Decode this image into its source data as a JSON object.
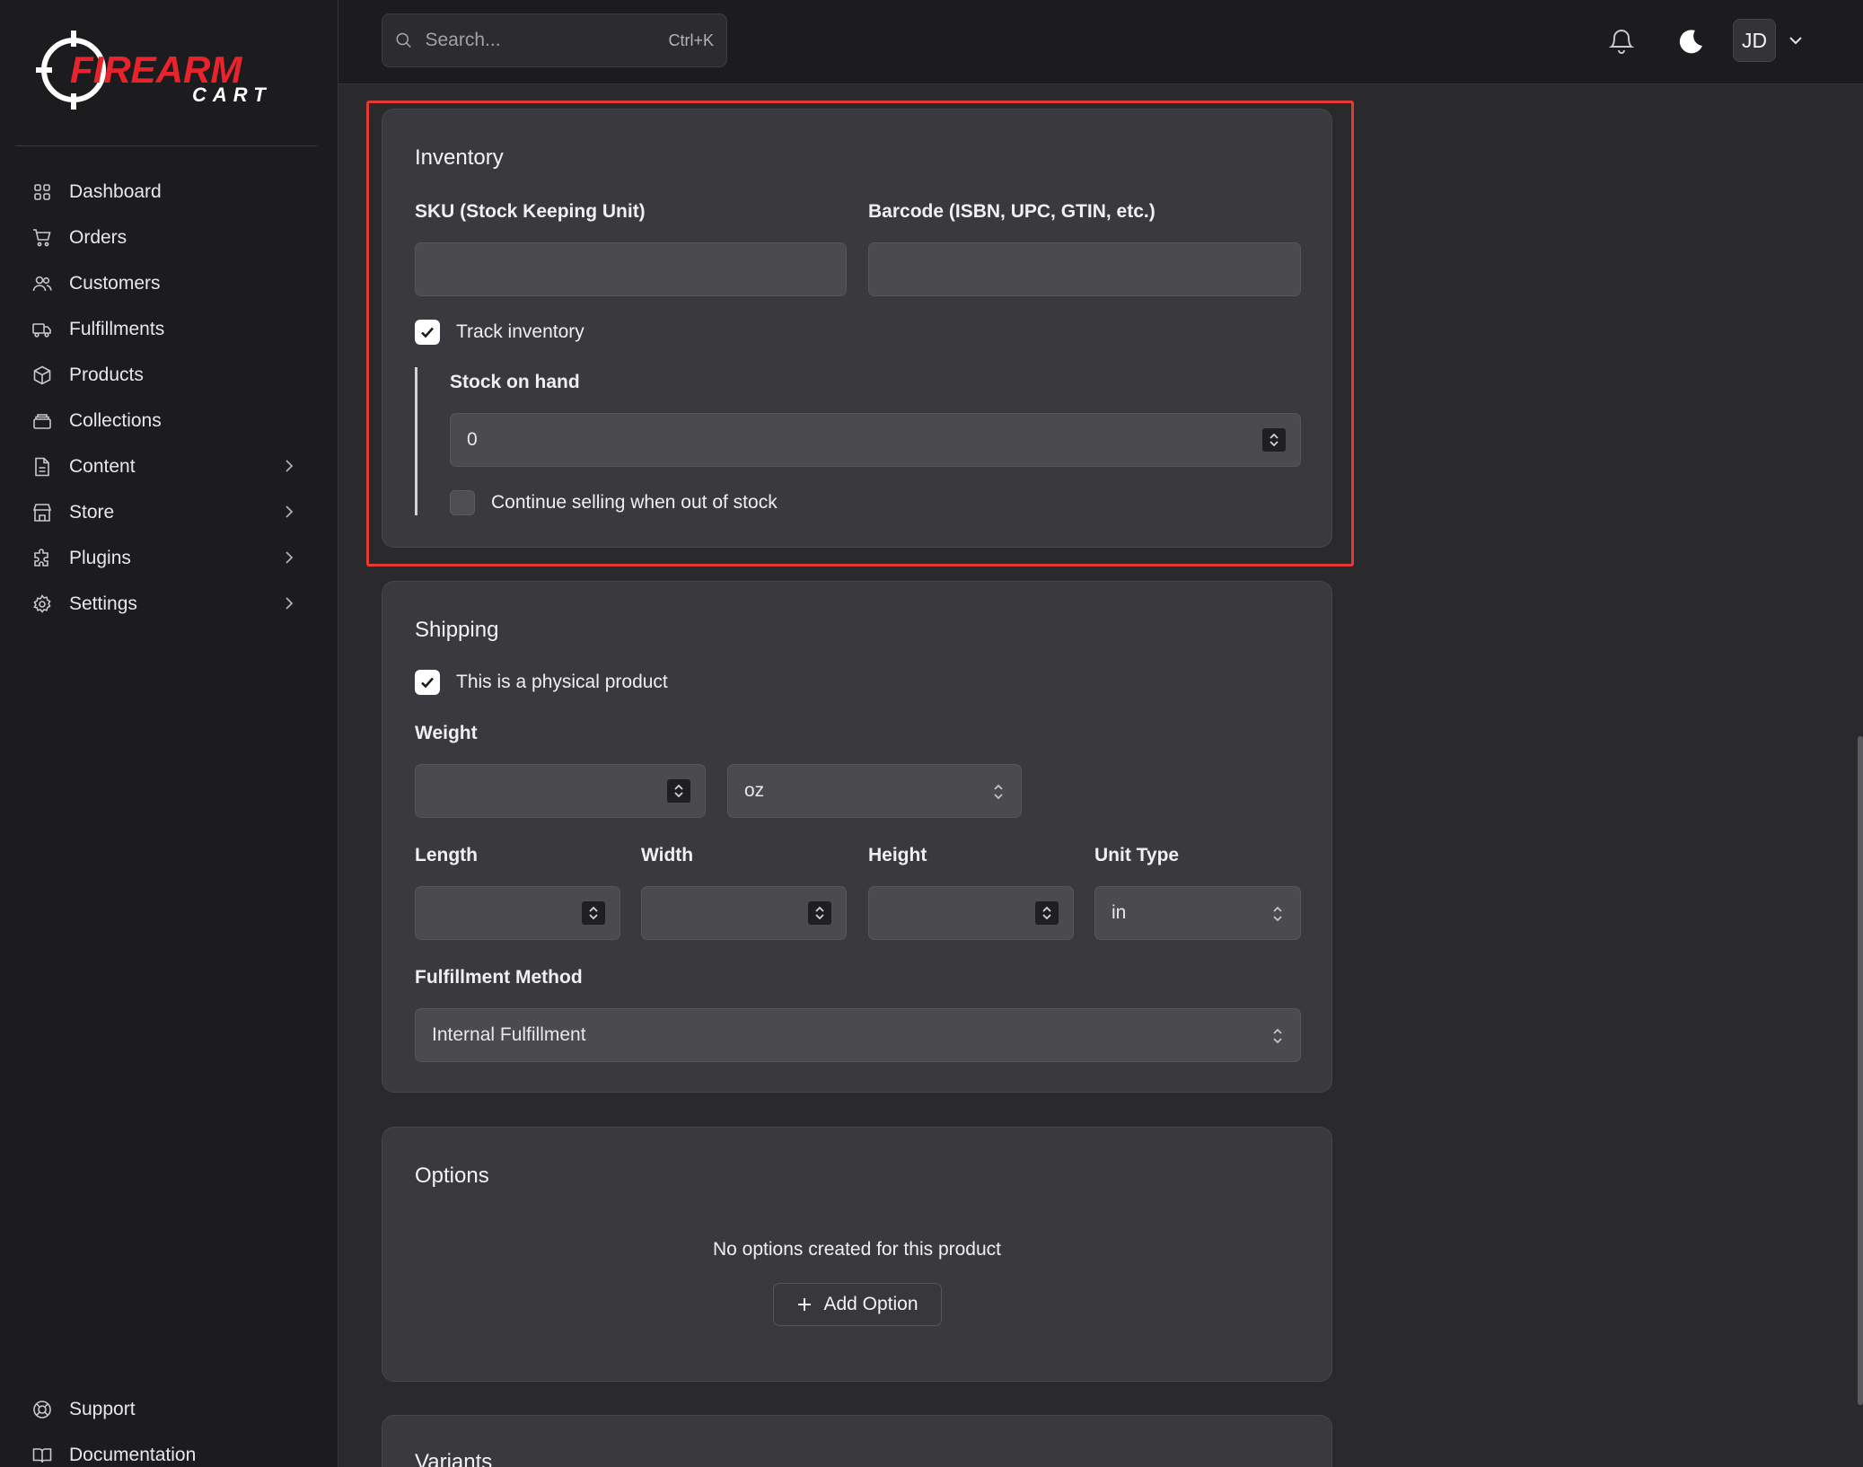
{
  "brand": {
    "logo_text_top": "FIREARM",
    "logo_text_bottom": "CART",
    "logo_color": "#e8232b"
  },
  "sidebar": {
    "items": [
      {
        "label": "Dashboard",
        "icon": "grid-icon"
      },
      {
        "label": "Orders",
        "icon": "cart-icon"
      },
      {
        "label": "Customers",
        "icon": "users-icon"
      },
      {
        "label": "Fulfillments",
        "icon": "truck-icon"
      },
      {
        "label": "Products",
        "icon": "box-icon"
      },
      {
        "label": "Collections",
        "icon": "archive-icon"
      },
      {
        "label": "Content",
        "icon": "file-icon",
        "has_submenu": true
      },
      {
        "label": "Store",
        "icon": "store-icon",
        "has_submenu": true
      },
      {
        "label": "Plugins",
        "icon": "puzzle-icon",
        "has_submenu": true
      },
      {
        "label": "Settings",
        "icon": "gear-icon",
        "has_submenu": true
      }
    ],
    "bottom_items": [
      {
        "label": "Support",
        "icon": "lifebuoy-icon"
      },
      {
        "label": "Documentation",
        "icon": "book-icon"
      }
    ]
  },
  "topbar": {
    "search_placeholder": "Search...",
    "search_shortcut": "Ctrl+K",
    "avatar_initials": "JD"
  },
  "inventory": {
    "title": "Inventory",
    "sku_label": "SKU (Stock Keeping Unit)",
    "sku_value": "",
    "barcode_label": "Barcode (ISBN, UPC, GTIN, etc.)",
    "barcode_value": "",
    "track_inventory_label": "Track inventory",
    "track_inventory_checked": true,
    "stock_label": "Stock on hand",
    "stock_value": "0",
    "continue_selling_label": "Continue selling when out of stock",
    "continue_selling_checked": false
  },
  "shipping": {
    "title": "Shipping",
    "physical_label": "This is a physical product",
    "physical_checked": true,
    "weight_label": "Weight",
    "weight_value": "",
    "weight_unit": "oz",
    "length_label": "Length",
    "width_label": "Width",
    "height_label": "Height",
    "unit_type_label": "Unit Type",
    "unit_type_value": "in",
    "fulfillment_label": "Fulfillment Method",
    "fulfillment_value": "Internal Fulfillment"
  },
  "options": {
    "title": "Options",
    "empty_text": "No options created for this product",
    "add_button": "Add Option"
  },
  "variants": {
    "title": "Variants"
  },
  "colors": {
    "highlight": "#e53935",
    "background": "#2a2a2d",
    "sidebar": "#1c1c1f",
    "card": "#3a3a3e"
  }
}
